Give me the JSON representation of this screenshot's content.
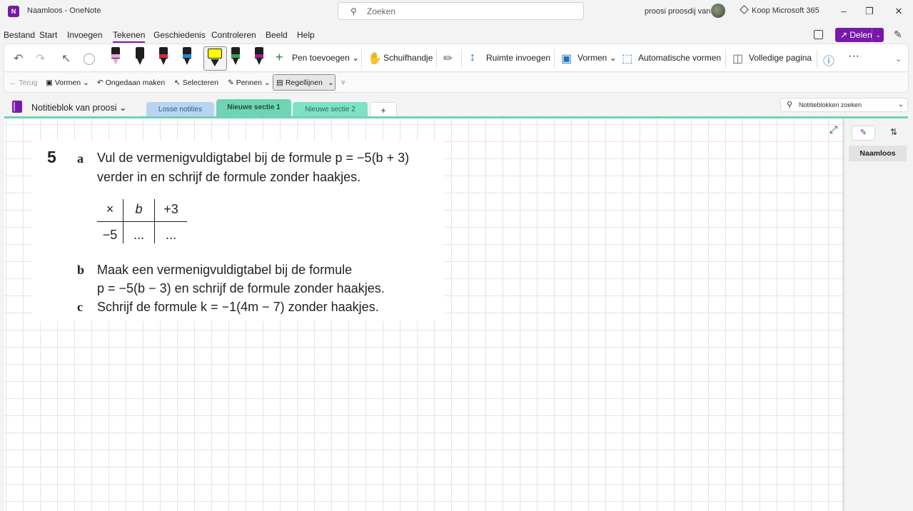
{
  "window": {
    "title": "Naamloos  -  OneNote",
    "search_placeholder": "Zoeken",
    "user_name": "proosi proosdij van",
    "buy_label": "Koop Microsoft 365"
  },
  "menu": {
    "items": [
      "Bestand",
      "Start",
      "Invoegen",
      "Tekenen",
      "Geschiedenis",
      "Controleren",
      "Beeld",
      "Help"
    ],
    "active": "Tekenen",
    "share_label": "Delen"
  },
  "ribbon": {
    "add_pen": "Pen toevoegen",
    "pan": "Schuifhandje",
    "insert_space": "Ruimte invoegen",
    "shapes": "Vormen",
    "auto_shapes": "Automatische vormen",
    "full_page": "Volledige pagina",
    "more": "···",
    "pens": [
      {
        "color": "#e6a8d8"
      },
      {
        "color": "#1e1e1e"
      },
      {
        "color": "#d7263d"
      },
      {
        "color": "#1f8ad6"
      },
      {
        "color": "#ffff00"
      },
      {
        "color": "#2fa84f"
      },
      {
        "color": "#a31c8e"
      }
    ]
  },
  "subbar": {
    "back": "Terug",
    "shapes": "Vormen",
    "undo": "Ongedaan maken",
    "select": "Selecteren",
    "pens": "Pennen",
    "rule_lines": "Regellijnen"
  },
  "notebook": {
    "name": "Notitieblok van proosi",
    "search_placeholder": "Notitieblokken zoeken",
    "sections": [
      {
        "label": "Losse notities",
        "color": "#b9d3f0"
      },
      {
        "label": "Nieuwe sectie 1",
        "color": "#6fd3b4"
      },
      {
        "label": "Nieuwe sectie 2",
        "color": "#7fe0c4"
      }
    ],
    "add_section": "+"
  },
  "exercise": {
    "number": "5",
    "a_letter": "a",
    "a_line1": "Vul de vermenigvuldigtabel bij de formule p = −5(b + 3)",
    "a_line2": "verder in en schrijf de formule zonder haakjes.",
    "table": {
      "header": [
        "×",
        "b",
        "+3"
      ],
      "row": [
        "−5",
        "...",
        "..."
      ]
    },
    "b_letter": "b",
    "b_line1": "Maak een vermenigvuldigtabel bij de formule",
    "b_line2": "p = −5(b − 3) en schrijf de formule zonder haakjes.",
    "c_letter": "c",
    "c_line1": "Schrijf de formule k = −1(4m − 7) zonder haakjes."
  },
  "pages": {
    "items": [
      "Naamloos"
    ]
  },
  "colors": {
    "accent": "#7719aa",
    "grid": "#dce6f2",
    "section_active": "#6fd3b4"
  }
}
